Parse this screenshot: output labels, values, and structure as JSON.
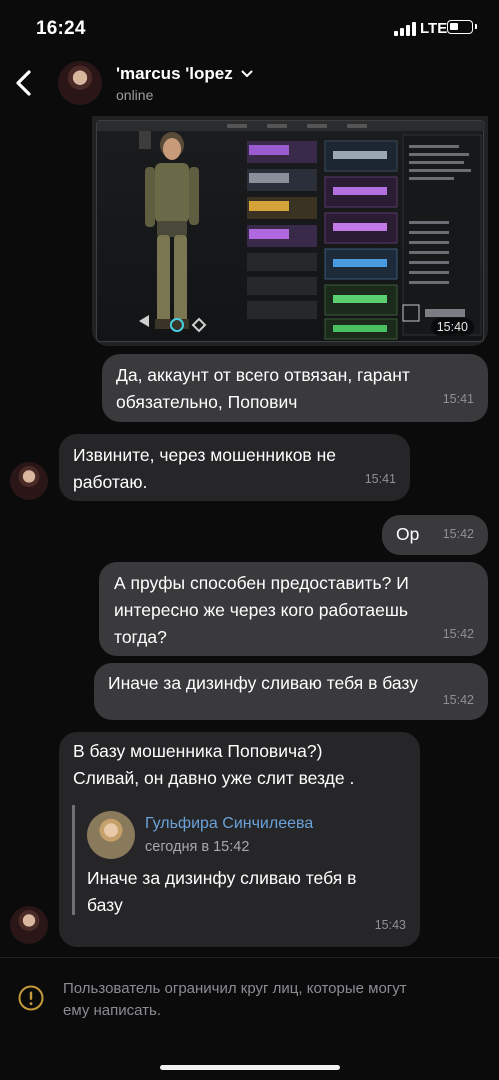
{
  "status_bar": {
    "time": "16:24",
    "network": "LTE"
  },
  "header": {
    "name": "'marcus 'lopez",
    "status": "online",
    "avatar_icon": "user-avatar"
  },
  "messages": [
    {
      "id": "m0",
      "type": "image",
      "direction": "out",
      "time": "15:40"
    },
    {
      "id": "m1",
      "direction": "out",
      "lines": [
        "Да, аккаунт от всего отвязан, гарант",
        "обязательно, Попович"
      ],
      "time": "15:41"
    },
    {
      "id": "m2",
      "direction": "in",
      "lines": [
        "Извините, через мошенников не",
        "работаю."
      ],
      "time": "15:41"
    },
    {
      "id": "m3",
      "direction": "out",
      "lines": [
        "Ор"
      ],
      "time": "15:42"
    },
    {
      "id": "m4",
      "direction": "out",
      "lines": [
        "А пруфы способен предоставить? И",
        "интересно же через кого работаешь",
        "тогда?"
      ],
      "time": "15:42"
    },
    {
      "id": "m5",
      "direction": "out",
      "lines": [
        "Иначе за дизинфу сливаю тебя в базу"
      ],
      "time": "15:42"
    },
    {
      "id": "m6",
      "direction": "in",
      "lines": [
        "В базу мошенника Поповича?)",
        "Сливай, он давно уже слит везде ."
      ],
      "time": "15:43",
      "reply": {
        "name": "Гульфира Синчилеева",
        "time": "сегодня в 15:42",
        "lines": [
          "Иначе за дизинфу сливаю тебя в",
          "базу"
        ]
      }
    }
  ],
  "notice": {
    "lines": [
      "Пользователь ограничил круг лиц, которые могут",
      "ему написать."
    ],
    "icon": "warning-icon"
  },
  "colors": {
    "bubble_out": "#3a3a3d",
    "bubble_in": "#262628",
    "reply_name": "#6aa2d8",
    "warning": "#c49a3a"
  }
}
